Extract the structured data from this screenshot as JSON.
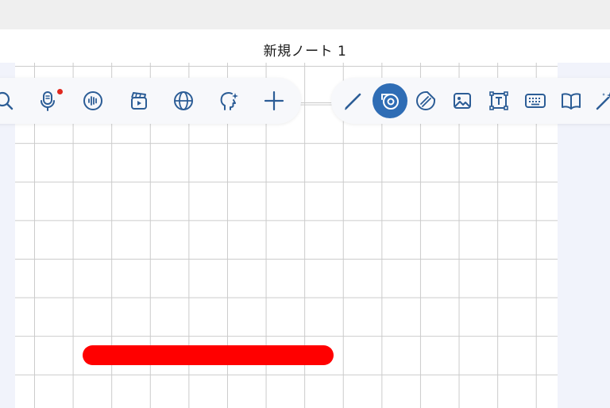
{
  "window": {
    "title": "新規ノート 1"
  },
  "colors": {
    "accent": "#2f6db5",
    "icon": "#2c5d96",
    "record_dot": "#e0281f",
    "ink_stroke": "#ff0000",
    "grid_line": "#cbcbcb",
    "side_panel": "#f1f3fb"
  },
  "toolbar_left": {
    "tools": [
      {
        "icon": "search-icon"
      },
      {
        "icon": "microphone-icon",
        "recording": true
      },
      {
        "icon": "audio-wave-icon"
      },
      {
        "icon": "video-clip-icon"
      },
      {
        "icon": "globe-icon"
      },
      {
        "icon": "ai-head-icon"
      },
      {
        "icon": "plus-icon"
      }
    ]
  },
  "toolbar_right": {
    "selected_tool": "tape-icon",
    "tools": [
      {
        "icon": "pen-icon"
      },
      {
        "icon": "tape-icon"
      },
      {
        "icon": "sticker-icon"
      },
      {
        "icon": "image-icon"
      },
      {
        "icon": "text-box-icon"
      },
      {
        "icon": "keyboard-icon"
      },
      {
        "icon": "book-icon"
      },
      {
        "icon": "magic-wand-icon"
      }
    ]
  }
}
